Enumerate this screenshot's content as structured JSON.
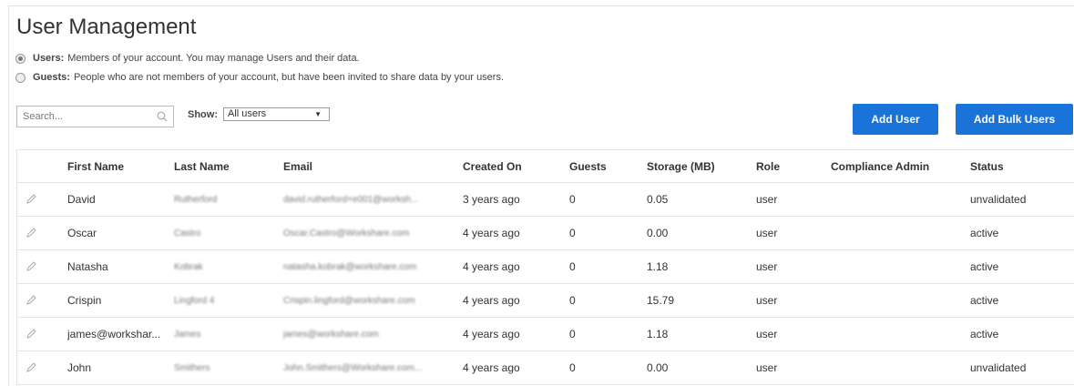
{
  "page": {
    "title": "User Management"
  },
  "filters": {
    "users_option": {
      "label": "Users:",
      "description": "Members of your account. You may manage Users and their data."
    },
    "guests_option": {
      "label": "Guests:",
      "description": "People who are not members of your account, but have been invited to share data by your users."
    },
    "search_placeholder": "Search...",
    "show_label": "Show:",
    "show_value": "All users"
  },
  "actions": {
    "add_user": "Add User",
    "add_bulk_users": "Add Bulk Users"
  },
  "table": {
    "columns": [
      "First Name",
      "Last Name",
      "Email",
      "Created On",
      "Guests",
      "Storage (MB)",
      "Role",
      "Compliance Admin",
      "Status"
    ],
    "rows": [
      {
        "first": "David",
        "last": "Rutherford",
        "email": "david.rutherford+e001@worksh...",
        "created": "3 years ago",
        "guests": "0",
        "storage": "0.05",
        "role": "user",
        "compliance": "",
        "status": "unvalidated"
      },
      {
        "first": "Oscar",
        "last": "Castro",
        "email": "Oscar.Castro@Workshare.com",
        "created": "4 years ago",
        "guests": "0",
        "storage": "0.00",
        "role": "user",
        "compliance": "",
        "status": "active"
      },
      {
        "first": "Natasha",
        "last": "Kobrak",
        "email": "natasha.kobrak@workshare.com",
        "created": "4 years ago",
        "guests": "0",
        "storage": "1.18",
        "role": "user",
        "compliance": "",
        "status": "active"
      },
      {
        "first": "Crispin",
        "last": "Lingford 4",
        "email": "Crispin.lingford@workshare.com",
        "created": "4 years ago",
        "guests": "0",
        "storage": "15.79",
        "role": "user",
        "compliance": "",
        "status": "active"
      },
      {
        "first": "james@workshar...",
        "last": "James",
        "email": "james@workshare.com",
        "created": "4 years ago",
        "guests": "0",
        "storage": "1.18",
        "role": "user",
        "compliance": "",
        "status": "active"
      },
      {
        "first": "John",
        "last": "Smithers",
        "email": "John.Smithers@Workshare.com...",
        "created": "4 years ago",
        "guests": "0",
        "storage": "0.00",
        "role": "user",
        "compliance": "",
        "status": "unvalidated"
      }
    ]
  },
  "colors": {
    "primary_button": "#1a73d9",
    "border": "#e4e4e4"
  },
  "icons": {
    "search": "search-icon",
    "edit": "pencil-icon",
    "dropdown": "chevron-down-icon"
  }
}
